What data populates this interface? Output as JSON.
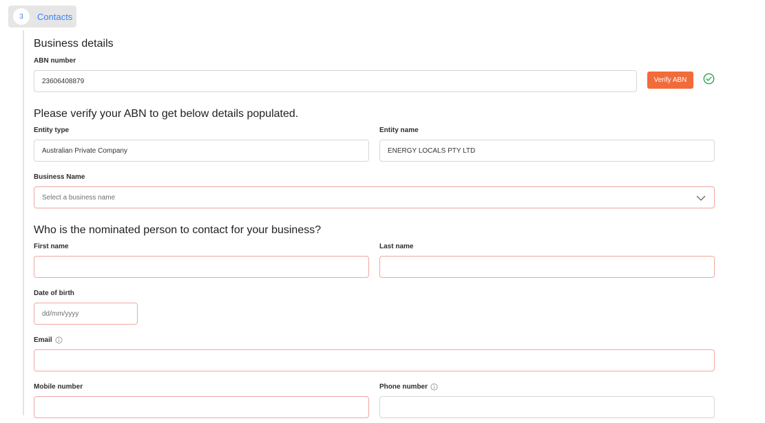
{
  "step": {
    "number": "3",
    "label": "Contacts"
  },
  "business": {
    "title": "Business details",
    "abn_label": "ABN number",
    "abn_value": "23606408879",
    "verify_button": "Verify ABN",
    "verified_icon": "check-circle-icon"
  },
  "details": {
    "title": "Please verify your ABN to get below details populated.",
    "entity_type_label": "Entity type",
    "entity_type_value": "Australian Private Company",
    "entity_name_label": "Entity name",
    "entity_name_value": "ENERGY LOCALS PTY LTD",
    "business_name_label": "Business Name",
    "business_name_placeholder": "Select a business name"
  },
  "contact": {
    "title": "Who is the nominated person to contact for your business?",
    "first_name_label": "First name",
    "last_name_label": "Last name",
    "dob_label": "Date of birth",
    "dob_placeholder": "dd/mm/yyyy",
    "email_label": "Email",
    "mobile_label": "Mobile number",
    "phone_label": "Phone number"
  },
  "colors": {
    "accent": "#f26b3a",
    "step_blue": "#3b82f6",
    "error_border": "#f0a7a1",
    "success": "#2e9e4f"
  }
}
